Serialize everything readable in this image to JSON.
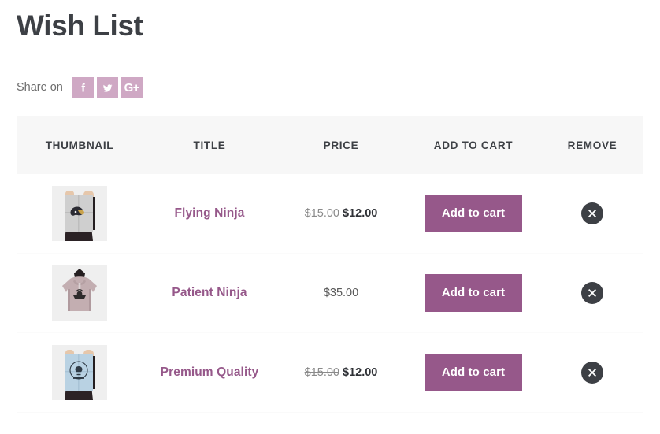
{
  "page": {
    "title": "Wish List"
  },
  "share": {
    "label": "Share on",
    "buttons": [
      {
        "name": "facebook",
        "icon": "facebook-icon",
        "glyph": "f"
      },
      {
        "name": "twitter",
        "icon": "twitter-icon",
        "glyph": "t"
      },
      {
        "name": "googleplus",
        "icon": "google-plus-icon",
        "glyph": "G+"
      }
    ],
    "accent_color": "#cfa8c4"
  },
  "table": {
    "headers": {
      "thumbnail": "THUMBNAIL",
      "title": "TITLE",
      "price": "PRICE",
      "add_to_cart": "ADD TO CART",
      "remove": "REMOVE"
    },
    "header_bg": "#f7f7f7",
    "rows": [
      {
        "thumbnail_icon": "product-poster-ninja-thumbnail",
        "title": "Flying Ninja",
        "price_old": "$15.00",
        "price_new": "$12.00",
        "on_sale": true,
        "add_to_cart_label": "Add to cart",
        "remove_icon": "remove-circle-x-icon"
      },
      {
        "thumbnail_icon": "product-hoodie-thumbnail",
        "title": "Patient Ninja",
        "price_old": "",
        "price_new": "$35.00",
        "on_sale": false,
        "add_to_cart_label": "Add to cart",
        "remove_icon": "remove-circle-x-icon"
      },
      {
        "thumbnail_icon": "product-poster-blue-thumbnail",
        "title": "Premium Quality",
        "price_old": "$15.00",
        "price_new": "$12.00",
        "on_sale": true,
        "add_to_cart_label": "Add to cart",
        "remove_icon": "remove-circle-x-icon"
      }
    ]
  },
  "colors": {
    "accent_purple": "#96588a",
    "share_pink": "#cfa8c4",
    "text_dark": "#3d4045",
    "remove_circle": "#3d4045"
  }
}
